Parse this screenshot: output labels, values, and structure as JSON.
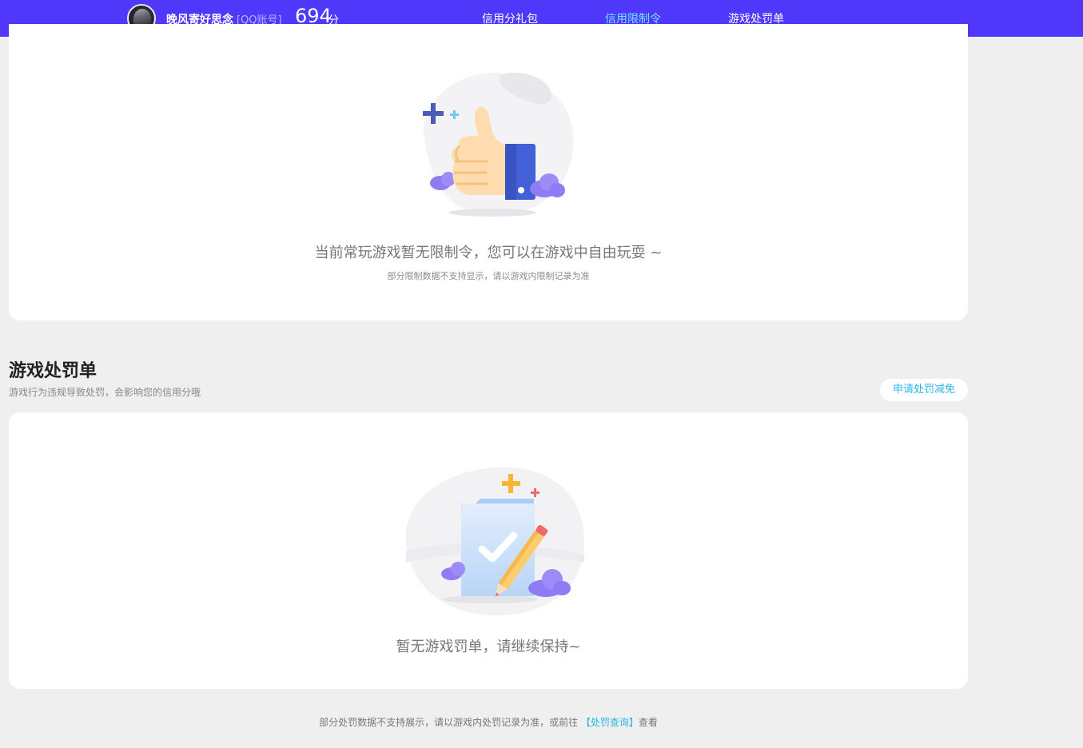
{
  "header": {
    "username": "晚风寄好思念",
    "account_type": "[QQ账号]",
    "score": "694",
    "score_unit": "分",
    "tabs": [
      {
        "label": "信用分礼包",
        "active": false
      },
      {
        "label": "信用限制令",
        "active": true
      },
      {
        "label": "游戏处罚单",
        "active": false
      }
    ],
    "colors": {
      "bar": "#5038fa",
      "active_tab": "#6ee7ff"
    }
  },
  "restriction": {
    "empty_title": "当前常玩游戏暂无限制令，您可以在游戏中自由玩耍 ~",
    "empty_note": "部分限制数据不支持显示，请以游戏内限制记录为准",
    "illustration_icon": "thumbs-up-icon"
  },
  "penalty": {
    "title": "游戏处罚单",
    "description": "游戏行为违规导致处罚，会影响您的信用分哦",
    "appeal_button": "申请处罚减免",
    "empty_title": "暂无游戏罚单，请继续保持~",
    "illustration_icon": "checklist-pencil-icon"
  },
  "footer": {
    "text_before": "部分处罚数据不支持展示，请以游戏内处罚记录为准，或前往 ",
    "link": "【处罚查询】",
    "text_after": "查看",
    "link_color": "#2bb5ea"
  }
}
